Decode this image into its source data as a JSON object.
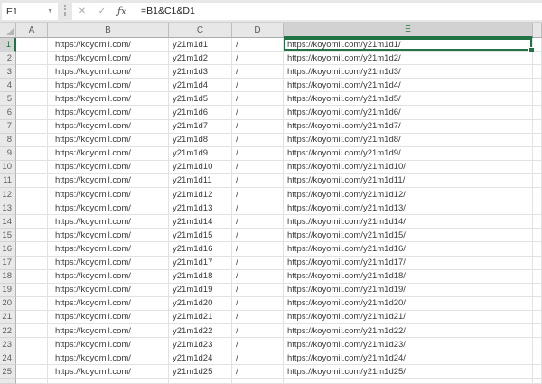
{
  "toolbar": {
    "name_box_value": "E1",
    "chevron_icon": "▼",
    "cancel_icon": "✕",
    "enter_icon": "✓",
    "fx_icon": "ƒx",
    "formula": "=B1&C1&D1"
  },
  "selection": {
    "active_cell": "E1",
    "row": 1,
    "col": "E"
  },
  "colors": {
    "accent_green": "#217346",
    "header_bg": "#e7e7e7",
    "selected_header_bg": "#d2d2d2",
    "gridline": "#e2e2e2",
    "toolbar_bg": "#e7e7e7"
  },
  "grid": {
    "column_headers": [
      "A",
      "B",
      "C",
      "D",
      "E"
    ],
    "rows": [
      {
        "n": "1",
        "a": "",
        "b": "https://koyomil.com/",
        "c": "y21m1d1",
        "d": "/",
        "e": "https://koyomil.com/y21m1d1/"
      },
      {
        "n": "2",
        "a": "",
        "b": "https://koyomil.com/",
        "c": "y21m1d2",
        "d": "/",
        "e": "https://koyomil.com/y21m1d2/"
      },
      {
        "n": "3",
        "a": "",
        "b": "https://koyomil.com/",
        "c": "y21m1d3",
        "d": "/",
        "e": "https://koyomil.com/y21m1d3/"
      },
      {
        "n": "4",
        "a": "",
        "b": "https://koyomil.com/",
        "c": "y21m1d4",
        "d": "/",
        "e": "https://koyomil.com/y21m1d4/"
      },
      {
        "n": "5",
        "a": "",
        "b": "https://koyomil.com/",
        "c": "y21m1d5",
        "d": "/",
        "e": "https://koyomil.com/y21m1d5/"
      },
      {
        "n": "6",
        "a": "",
        "b": "https://koyomil.com/",
        "c": "y21m1d6",
        "d": "/",
        "e": "https://koyomil.com/y21m1d6/"
      },
      {
        "n": "7",
        "a": "",
        "b": "https://koyomil.com/",
        "c": "y21m1d7",
        "d": "/",
        "e": "https://koyomil.com/y21m1d7/"
      },
      {
        "n": "8",
        "a": "",
        "b": "https://koyomil.com/",
        "c": "y21m1d8",
        "d": "/",
        "e": "https://koyomil.com/y21m1d8/"
      },
      {
        "n": "9",
        "a": "",
        "b": "https://koyomil.com/",
        "c": "y21m1d9",
        "d": "/",
        "e": "https://koyomil.com/y21m1d9/"
      },
      {
        "n": "10",
        "a": "",
        "b": "https://koyomil.com/",
        "c": "y21m1d10",
        "d": "/",
        "e": "https://koyomil.com/y21m1d10/"
      },
      {
        "n": "11",
        "a": "",
        "b": "https://koyomil.com/",
        "c": "y21m1d11",
        "d": "/",
        "e": "https://koyomil.com/y21m1d11/"
      },
      {
        "n": "12",
        "a": "",
        "b": "https://koyomil.com/",
        "c": "y21m1d12",
        "d": "/",
        "e": "https://koyomil.com/y21m1d12/"
      },
      {
        "n": "13",
        "a": "",
        "b": "https://koyomil.com/",
        "c": "y21m1d13",
        "d": "/",
        "e": "https://koyomil.com/y21m1d13/"
      },
      {
        "n": "14",
        "a": "",
        "b": "https://koyomil.com/",
        "c": "y21m1d14",
        "d": "/",
        "e": "https://koyomil.com/y21m1d14/"
      },
      {
        "n": "15",
        "a": "",
        "b": "https://koyomil.com/",
        "c": "y21m1d15",
        "d": "/",
        "e": "https://koyomil.com/y21m1d15/"
      },
      {
        "n": "16",
        "a": "",
        "b": "https://koyomil.com/",
        "c": "y21m1d16",
        "d": "/",
        "e": "https://koyomil.com/y21m1d16/"
      },
      {
        "n": "17",
        "a": "",
        "b": "https://koyomil.com/",
        "c": "y21m1d17",
        "d": "/",
        "e": "https://koyomil.com/y21m1d17/"
      },
      {
        "n": "18",
        "a": "",
        "b": "https://koyomil.com/",
        "c": "y21m1d18",
        "d": "/",
        "e": "https://koyomil.com/y21m1d18/"
      },
      {
        "n": "19",
        "a": "",
        "b": "https://koyomil.com/",
        "c": "y21m1d19",
        "d": "/",
        "e": "https://koyomil.com/y21m1d19/"
      },
      {
        "n": "20",
        "a": "",
        "b": "https://koyomil.com/",
        "c": "y21m1d20",
        "d": "/",
        "e": "https://koyomil.com/y21m1d20/"
      },
      {
        "n": "21",
        "a": "",
        "b": "https://koyomil.com/",
        "c": "y21m1d21",
        "d": "/",
        "e": "https://koyomil.com/y21m1d21/"
      },
      {
        "n": "22",
        "a": "",
        "b": "https://koyomil.com/",
        "c": "y21m1d22",
        "d": "/",
        "e": "https://koyomil.com/y21m1d22/"
      },
      {
        "n": "23",
        "a": "",
        "b": "https://koyomil.com/",
        "c": "y21m1d23",
        "d": "/",
        "e": "https://koyomil.com/y21m1d23/"
      },
      {
        "n": "24",
        "a": "",
        "b": "https://koyomil.com/",
        "c": "y21m1d24",
        "d": "/",
        "e": "https://koyomil.com/y21m1d24/"
      },
      {
        "n": "25",
        "a": "",
        "b": "https://koyomil.com/",
        "c": "y21m1d25",
        "d": "/",
        "e": "https://koyomil.com/y21m1d25/"
      }
    ]
  }
}
